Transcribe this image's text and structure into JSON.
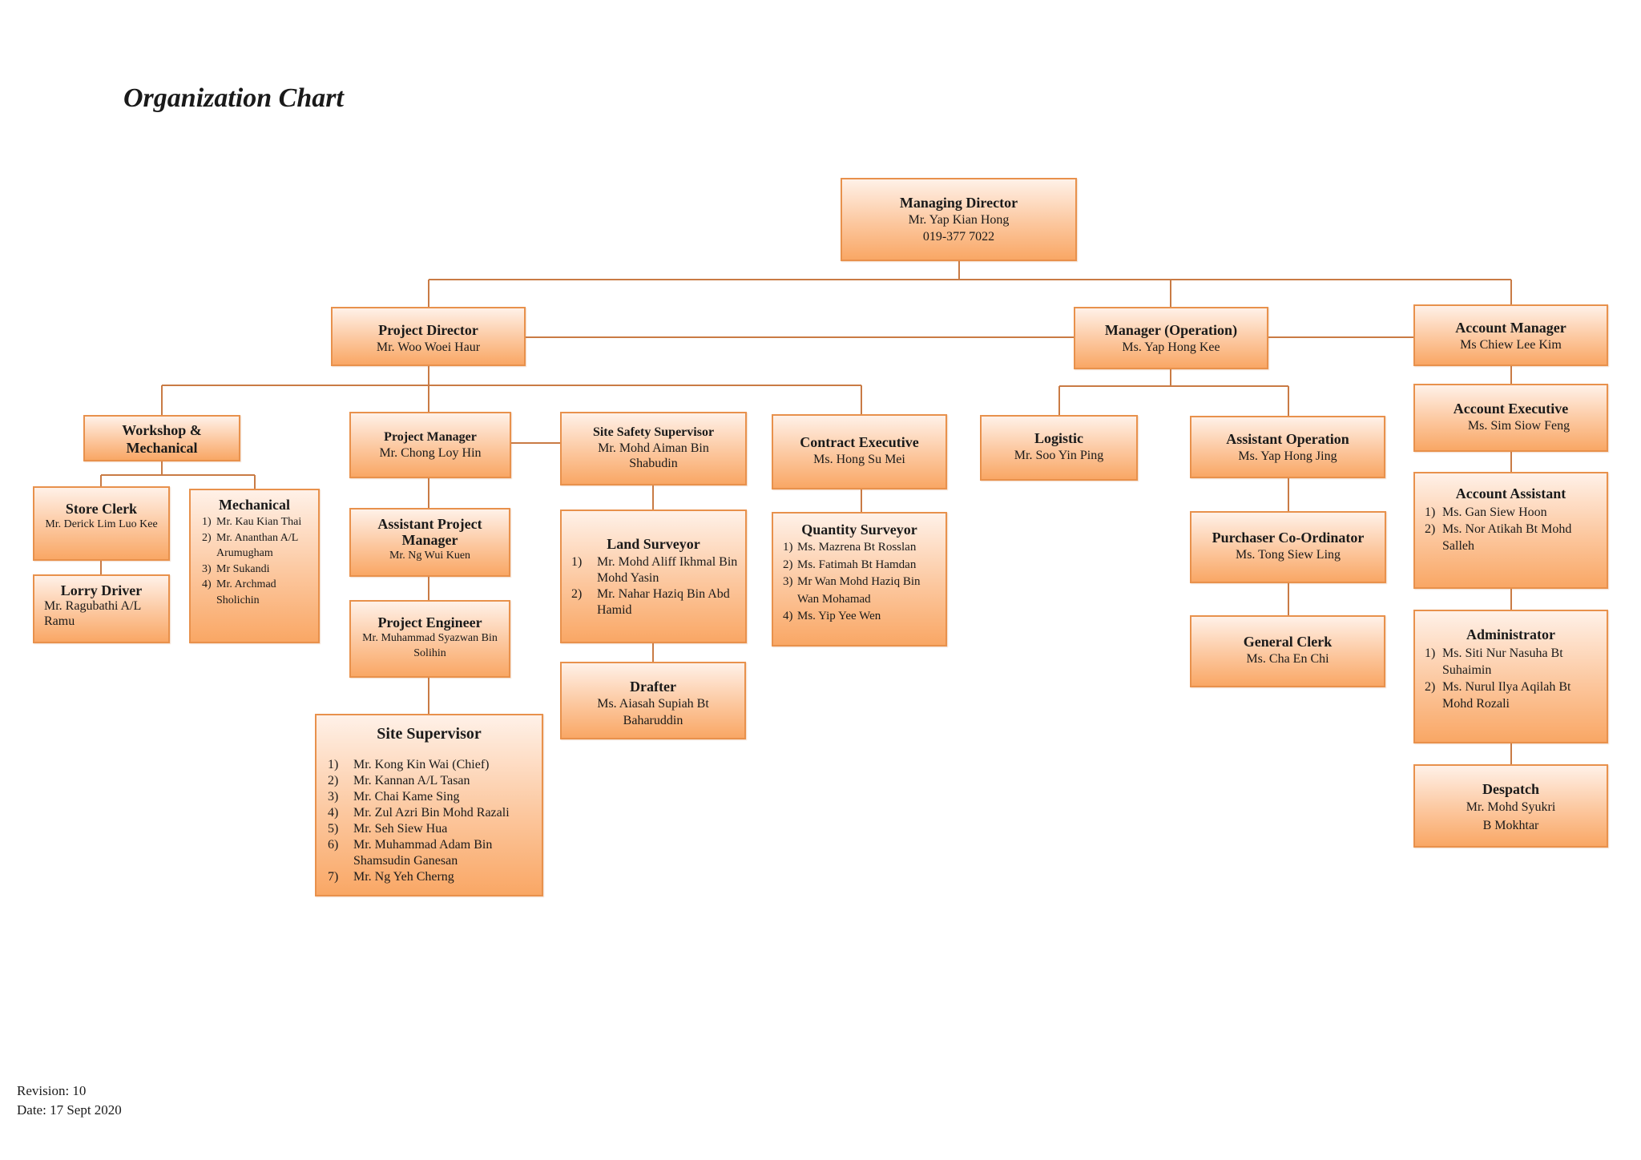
{
  "title": "Organization Chart",
  "footer": {
    "revision": "Revision: 10",
    "date": "Date: 17 Sept 2020"
  },
  "colors": {
    "box_top": "#FFF1E8",
    "box_bottom": "#F9A765",
    "border": "#E8914C",
    "connector": "#C97B45"
  },
  "nodes": {
    "md": {
      "title": "Managing Director",
      "names": [
        "Mr. Yap Kian Hong",
        "019-377 7022"
      ]
    },
    "pd": {
      "title": "Project Director",
      "names": [
        "Mr. Woo Woei Haur"
      ]
    },
    "mo": {
      "title": "Manager (Operation)",
      "names": [
        "Ms. Yap Hong Kee"
      ]
    },
    "am": {
      "title": "Account Manager",
      "names": [
        "Ms Chiew Lee Kim"
      ]
    },
    "wm": {
      "title": "Workshop & Mechanical",
      "names": []
    },
    "sc": {
      "title": "Store Clerk",
      "names": [
        "Mr. Derick Lim Luo Kee"
      ]
    },
    "ld": {
      "title": "Lorry Driver",
      "names": [
        "Mr. Ragubathi A/L Ramu"
      ]
    },
    "mech": {
      "title": "Mechanical",
      "list": [
        {
          "num": "1)",
          "name": "Mr. Kau Kian Thai"
        },
        {
          "num": "2)",
          "name": "Mr. Ananthan A/L Arumugham"
        },
        {
          "num": "3)",
          "name": "Mr Sukandi"
        },
        {
          "num": "4)",
          "name": "Mr. Archmad Sholichin"
        }
      ]
    },
    "pm": {
      "title": "Project Manager",
      "names": [
        "Mr. Chong Loy Hin"
      ]
    },
    "apm": {
      "title": "Assistant Project Manager",
      "names": [
        "Mr. Ng Wui Kuen"
      ]
    },
    "pe": {
      "title": "Project Engineer",
      "names": [
        "Mr. Muhammad Syazwan Bin Solihin"
      ]
    },
    "ss": {
      "title": "Site Supervisor",
      "list": [
        {
          "num": "1)",
          "name": "Mr. Kong Kin Wai (Chief)"
        },
        {
          "num": "2)",
          "name": "Mr. Kannan A/L Tasan"
        },
        {
          "num": "3)",
          "name": "Mr. Chai Kame Sing"
        },
        {
          "num": "4)",
          "name": "Mr. Zul Azri Bin Mohd Razali"
        },
        {
          "num": "5)",
          "name": "Mr. Seh Siew Hua"
        },
        {
          "num": "6)",
          "name": "Mr. Muhammad Adam Bin Shamsudin Ganesan"
        },
        {
          "num": "7)",
          "name": "Mr. Ng Yeh Cherng"
        }
      ]
    },
    "sss": {
      "title": "Site Safety Supervisor",
      "names": [
        "Mr. Mohd Aiman Bin Shabudin"
      ]
    },
    "ls": {
      "title": "Land Surveyor",
      "list": [
        {
          "num": "1)",
          "name": "Mr. Mohd Aliff Ikhmal Bin Mohd Yasin"
        },
        {
          "num": "2)",
          "name": "Mr. Nahar Haziq Bin Abd Hamid"
        }
      ]
    },
    "dr": {
      "title": "Drafter",
      "names": [
        "Ms. Aiasah Supiah Bt Baharuddin"
      ]
    },
    "ce": {
      "title": "Contract Executive",
      "names": [
        "Ms. Hong Su Mei"
      ]
    },
    "qs": {
      "title": "Quantity Surveyor",
      "list": [
        {
          "num": "1)",
          "name": "Ms. Mazrena Bt Rosslan"
        },
        {
          "num": "2)",
          "name": "Ms. Fatimah Bt Hamdan"
        },
        {
          "num": "3)",
          "name": "Mr Wan Mohd Haziq Bin Wan Mohamad"
        },
        {
          "num": "4)",
          "name": "Ms. Yip Yee Wen"
        }
      ]
    },
    "lg": {
      "title": "Logistic",
      "names": [
        "Mr. Soo Yin Ping"
      ]
    },
    "ao": {
      "title": "Assistant Operation",
      "names": [
        "Ms. Yap Hong Jing"
      ]
    },
    "pc": {
      "title": "Purchaser Co-Ordinator",
      "names": [
        "Ms. Tong Siew Ling"
      ]
    },
    "gc": {
      "title": "General Clerk",
      "names": [
        "Ms. Cha En Chi"
      ]
    },
    "ae": {
      "title": "Account Executive",
      "names": [
        "Ms. Sim Siow Feng"
      ]
    },
    "aa": {
      "title": "Account Assistant",
      "list": [
        {
          "num": "1)",
          "name": "Ms. Gan Siew Hoon"
        },
        {
          "num": "2)",
          "name": "Ms. Nor Atikah Bt Mohd Salleh"
        }
      ]
    },
    "adm": {
      "title": "Administrator",
      "list": [
        {
          "num": "1)",
          "name": "Ms. Siti Nur Nasuha Bt Suhaimin"
        },
        {
          "num": "2)",
          "name": "Ms. Nurul Ilya Aqilah Bt Mohd Rozali"
        }
      ]
    },
    "dp": {
      "title": "Despatch",
      "names": [
        "Mr. Mohd Syukri",
        "B Mokhtar"
      ]
    }
  }
}
